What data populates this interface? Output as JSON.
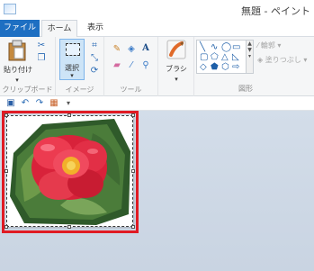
{
  "window": {
    "title": "無題 - ペイント"
  },
  "tabs": [
    {
      "label": "ファイル"
    },
    {
      "label": "ホーム"
    },
    {
      "label": "表示"
    }
  ],
  "ribbon": {
    "clipboard": {
      "paste_label": "貼り付け",
      "group_label": "クリップボード"
    },
    "image": {
      "select_label": "選択",
      "group_label": "イメージ"
    },
    "tools": {
      "group_label": "ツール",
      "text_icon": "A"
    },
    "brushes": {
      "label": "ブラシ"
    },
    "shapes": {
      "group_label": "図形",
      "outline_label": "輪郭",
      "fill_label": "塗りつぶし"
    }
  },
  "icons": {
    "paste": "clipboard-icon",
    "cut": "scissors-icon",
    "copy": "copy-icon",
    "crop": "crop-icon",
    "resize": "resize-icon",
    "rotate": "rotate-icon",
    "pencil": "pencil-icon",
    "fill": "bucket-icon",
    "text": "text-icon",
    "eraser": "eraser-icon",
    "picker": "color-picker-icon",
    "magnifier": "magnifier-icon",
    "brush": "brush-icon",
    "save": "save-icon",
    "undo": "undo-icon",
    "redo": "redo-icon"
  },
  "colors": {
    "file_tab": "#1e6fc2",
    "selection": "#cde4f7",
    "highlight_border": "#e01b24",
    "canvas_bg": "#d3dde9"
  },
  "canvas": {
    "image_subject": "red camellia flower"
  }
}
